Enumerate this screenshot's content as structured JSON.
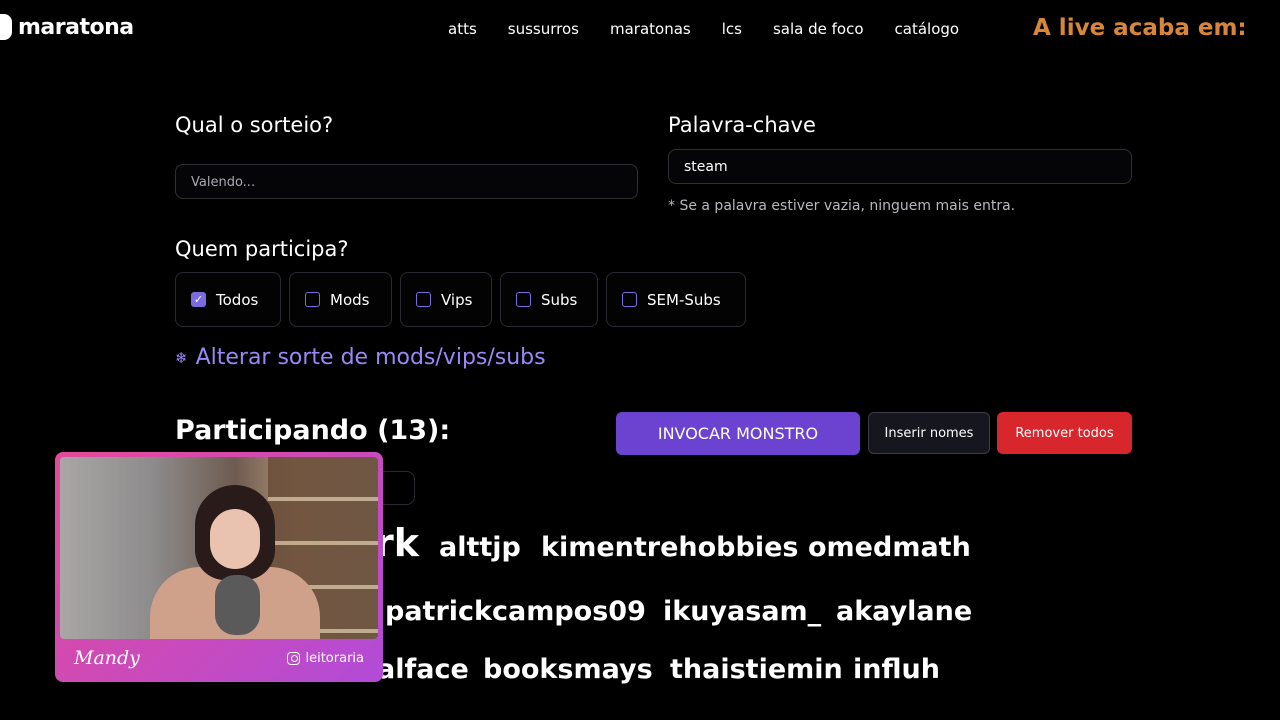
{
  "nav": {
    "logo": "maratona",
    "links": [
      "atts",
      "sussurros",
      "maratonas",
      "lcs",
      "sala de foco",
      "catálogo"
    ],
    "timer_label": "A live acaba em:"
  },
  "form": {
    "raffle_title": "Qual o sorteio?",
    "raffle_placeholder": "Valendo...",
    "keyword_title": "Palavra-chave",
    "keyword_value": "steam",
    "keyword_hint": "* Se a palavra estiver vazia, ninguem mais entra.",
    "participants_title": "Quem participa?",
    "options": [
      {
        "label": "Todos",
        "checked": true
      },
      {
        "label": "Mods",
        "checked": false
      },
      {
        "label": "Vips",
        "checked": false
      },
      {
        "label": "Subs",
        "checked": false
      },
      {
        "label": "SEM-Subs",
        "checked": false
      }
    ],
    "alter_link": "Alterar sorte de mods/vips/subs"
  },
  "participants": {
    "title": "Participando (13):",
    "invoke_button": "INVOCAR MONSTRO",
    "insert_button": "Inserir nomes",
    "remove_button": "Remover todos",
    "names": [
      "rk",
      "alttjp",
      "kimentrehobbies",
      "omedmath",
      "patrickcampos09",
      "ikuyasam_",
      "akaylane",
      "alface",
      "booksmays",
      "thaistiemin",
      "influh"
    ]
  },
  "webcam": {
    "name": "Mandy",
    "handle": "leitoraria"
  },
  "colors": {
    "accent": "#6c42d0",
    "link": "#9b87f5",
    "danger": "#d8262d",
    "timer": "#d8873a"
  }
}
